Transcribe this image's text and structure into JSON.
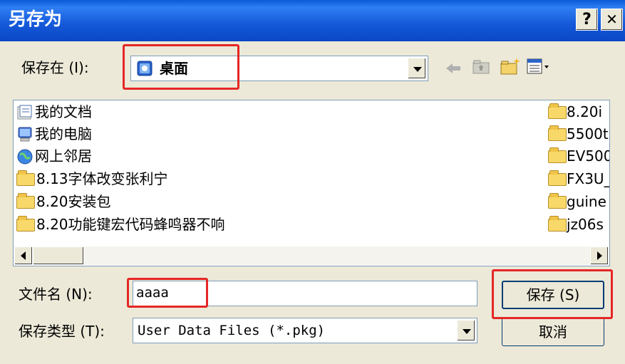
{
  "window": {
    "title": "另存为",
    "help_label": "?",
    "close_label": "✕"
  },
  "save_in": {
    "label": "保存在 (I):",
    "value": "桌面"
  },
  "toolbar": {
    "back_icon": "back-arrow-icon",
    "up_icon": "up-folder-icon",
    "new_folder_icon": "new-folder-icon",
    "view_menu_icon": "view-menu-icon"
  },
  "files": {
    "left": [
      {
        "label": "我的文档",
        "icon": "my-documents-icon"
      },
      {
        "label": "我的电脑",
        "icon": "my-computer-icon"
      },
      {
        "label": "网上邻居",
        "icon": "network-places-icon"
      },
      {
        "label": "8.13字体改变张利宁",
        "icon": "folder-icon"
      },
      {
        "label": "8.20安装包",
        "icon": "folder-icon"
      },
      {
        "label": "8.20功能键宏代码蜂鸣器不响",
        "icon": "folder-icon"
      }
    ],
    "right": [
      {
        "label": "8.20i",
        "icon": "folder-icon"
      },
      {
        "label": "5500t",
        "icon": "folder-icon"
      },
      {
        "label": "EV500",
        "icon": "folder-icon"
      },
      {
        "label": "FX3U_",
        "icon": "folder-icon"
      },
      {
        "label": "guine",
        "icon": "folder-icon"
      },
      {
        "label": "jz06s",
        "icon": "folder-icon"
      }
    ]
  },
  "filename": {
    "label": "文件名 (N):",
    "value": "aaaa"
  },
  "filetype": {
    "label": "保存类型 (T):",
    "value": "User Data Files (*.pkg)"
  },
  "buttons": {
    "save": "保存 (S)",
    "cancel": "取消"
  },
  "colors": {
    "title_bar": "#0a5ad8",
    "highlight": "#e52626",
    "dialog_bg": "#ece9d8"
  }
}
